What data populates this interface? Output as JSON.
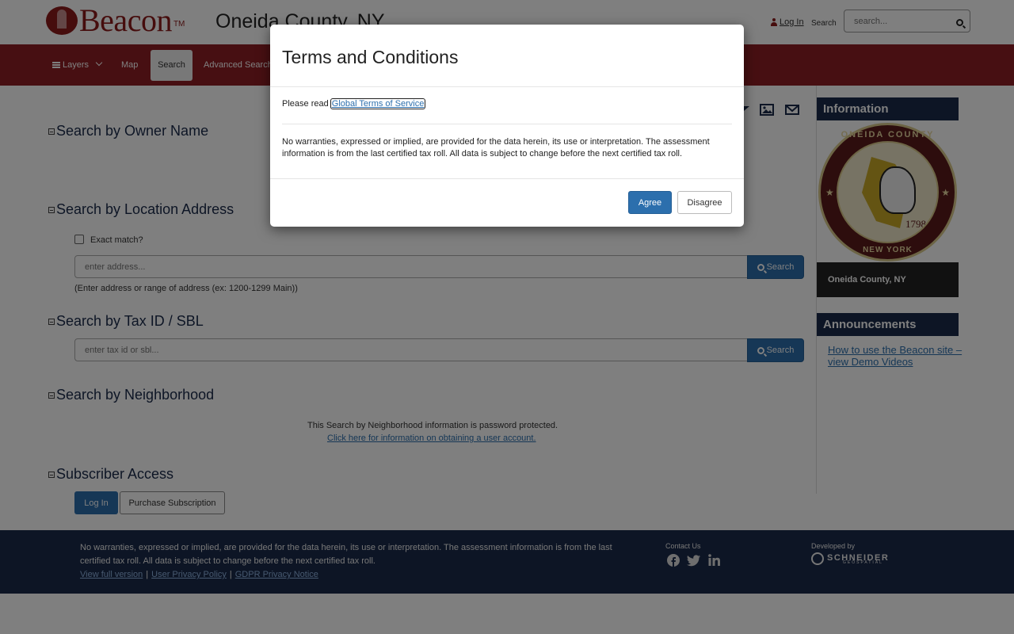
{
  "header": {
    "logo_text": "Beacon",
    "logo_tm": "TM",
    "county_title": "Oneida County, NY",
    "login_label": "Log In",
    "search_label": "Search",
    "search_placeholder": "search..."
  },
  "nav": {
    "items": [
      {
        "label": "Layers"
      },
      {
        "label": "Map"
      },
      {
        "label": "Search"
      },
      {
        "label": "Advanced Search"
      }
    ],
    "active": "Search"
  },
  "sections": {
    "owner": {
      "title": "Search by Owner Name"
    },
    "location": {
      "title": "Search by Location Address",
      "exact_match_label": "Exact match?",
      "placeholder": "enter address...",
      "button": "Search",
      "hint": "(Enter address or range of address (ex: 1200-1299 Main))"
    },
    "taxid": {
      "title": "Search by Tax ID / SBL",
      "placeholder": "enter tax id or sbl...",
      "button": "Search"
    },
    "neighborhood": {
      "title": "Search by Neighborhood",
      "notice": "This Search by Neighborhood information is password protected.",
      "link": "Click here for information on obtaining a user account."
    },
    "subscriber": {
      "title": "Subscriber Access",
      "login_button": "Log In",
      "purchase_button": "Purchase Subscription"
    }
  },
  "sidebar": {
    "info_title": "Information",
    "seal": {
      "top": "ONEIDA COUNTY",
      "bottom": "NEW YORK",
      "year": "1798"
    },
    "caption": "Oneida County, NY",
    "announcements_title": "Announcements",
    "announcement_link": "How to use the Beacon site – view Demo Videos"
  },
  "footer": {
    "disclaimer": "No warranties, expressed or implied, are provided for the data herein, its use or interpretation. The assessment information is from the last certified tax roll. All data is subject to change before the next certified tax roll.",
    "links": [
      "View full version",
      "User Privacy Policy",
      "GDPR Privacy Notice"
    ],
    "contact_label": "Contact Us",
    "developed_label": "Developed by",
    "developer": "SCHNEIDER",
    "developer_sub": "GEOSPATIAL"
  },
  "modal": {
    "title": "Terms and Conditions",
    "read_prefix": "Please read",
    "terms_link": "Global Terms of Service",
    "disclaimer": "No warranties, expressed or implied, are provided for the data herein, its use or interpretation. The assessment information is from the last certified tax roll. All data is subject to change before the next certified tax roll.",
    "agree": "Agree",
    "disagree": "Disagree"
  },
  "colors": {
    "brand_red": "#8f1f24",
    "navy": "#1a2a4a",
    "primary_blue": "#2c6fad"
  }
}
